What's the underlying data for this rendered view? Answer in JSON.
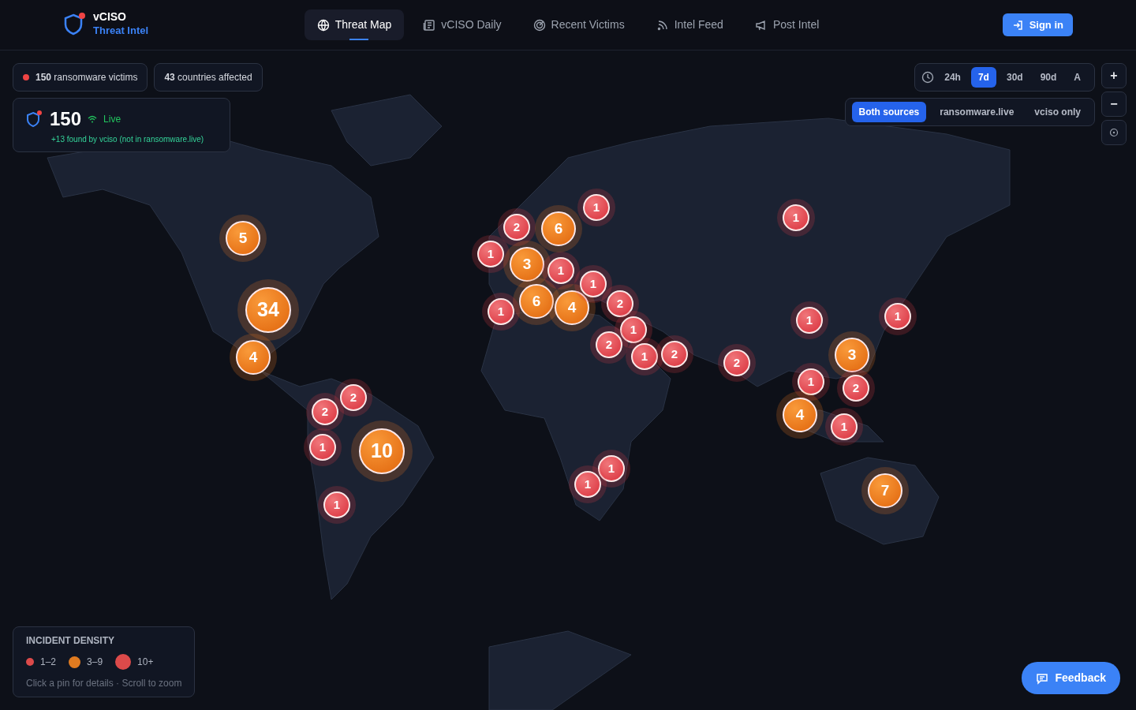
{
  "brand": {
    "name": "vCISO",
    "subtitle": "Threat Intel"
  },
  "nav": [
    {
      "label": "Threat Map",
      "selected": true
    },
    {
      "label": "vCISO Daily",
      "selected": false
    },
    {
      "label": "Recent Victims",
      "selected": false
    },
    {
      "label": "Intel Feed",
      "selected": false
    },
    {
      "label": "Post Intel",
      "selected": false
    }
  ],
  "sign_in": "Sign in",
  "stats": {
    "victims_count": "150",
    "victims_label": "ransomware victims",
    "countries_count": "43",
    "countries_label": "countries affected",
    "total": "150",
    "live": "Live",
    "note": "+13 found by vciso (not in ransomware.live)"
  },
  "time_filter": [
    {
      "label": "24h",
      "selected": false
    },
    {
      "label": "7d",
      "selected": true
    },
    {
      "label": "30d",
      "selected": false
    },
    {
      "label": "90d",
      "selected": false
    },
    {
      "label": "A",
      "selected": false
    }
  ],
  "source_filter": [
    {
      "label": "Both sources",
      "selected": true
    },
    {
      "label": "ransomware.live",
      "selected": false
    },
    {
      "label": "vciso only",
      "selected": false
    }
  ],
  "zoom": {
    "in": "+",
    "out": "−"
  },
  "pins": [
    {
      "count": "5",
      "kind": "mid"
    },
    {
      "count": "34",
      "kind": "high"
    },
    {
      "count": "4",
      "kind": "mid"
    },
    {
      "count": "2",
      "kind": "low"
    },
    {
      "count": "2",
      "kind": "low"
    },
    {
      "count": "1",
      "kind": "low"
    },
    {
      "count": "10",
      "kind": "high"
    },
    {
      "count": "1",
      "kind": "low"
    },
    {
      "count": "1",
      "kind": "low"
    },
    {
      "count": "2",
      "kind": "low"
    },
    {
      "count": "1",
      "kind": "low"
    },
    {
      "count": "3",
      "kind": "mid"
    },
    {
      "count": "6",
      "kind": "mid"
    },
    {
      "count": "6",
      "kind": "mid"
    },
    {
      "count": "1",
      "kind": "low"
    },
    {
      "count": "4",
      "kind": "mid"
    },
    {
      "count": "1",
      "kind": "low"
    },
    {
      "count": "1",
      "kind": "low"
    },
    {
      "count": "2",
      "kind": "low"
    },
    {
      "count": "1",
      "kind": "low"
    },
    {
      "count": "2",
      "kind": "low"
    },
    {
      "count": "1",
      "kind": "low"
    },
    {
      "count": "2",
      "kind": "low"
    },
    {
      "count": "2",
      "kind": "low"
    },
    {
      "count": "1",
      "kind": "low"
    },
    {
      "count": "1",
      "kind": "low"
    },
    {
      "count": "1",
      "kind": "low"
    },
    {
      "count": "3",
      "kind": "mid"
    },
    {
      "count": "2",
      "kind": "low"
    },
    {
      "count": "1",
      "kind": "low"
    },
    {
      "count": "4",
      "kind": "mid"
    },
    {
      "count": "1",
      "kind": "low"
    },
    {
      "count": "1",
      "kind": "low"
    },
    {
      "count": "1",
      "kind": "low"
    },
    {
      "count": "7",
      "kind": "mid"
    }
  ],
  "legend": {
    "title": "INCIDENT DENSITY",
    "items": [
      {
        "label": "1–2",
        "color": "#dc4a4a",
        "kind": "small"
      },
      {
        "label": "3–9",
        "color": "#e07b20",
        "kind": "medium"
      },
      {
        "label": "10+",
        "color": "#dc4a4a",
        "kind": "large"
      }
    ],
    "hint": "Click a pin for details · Scroll to zoom"
  },
  "feedback": "Feedback"
}
